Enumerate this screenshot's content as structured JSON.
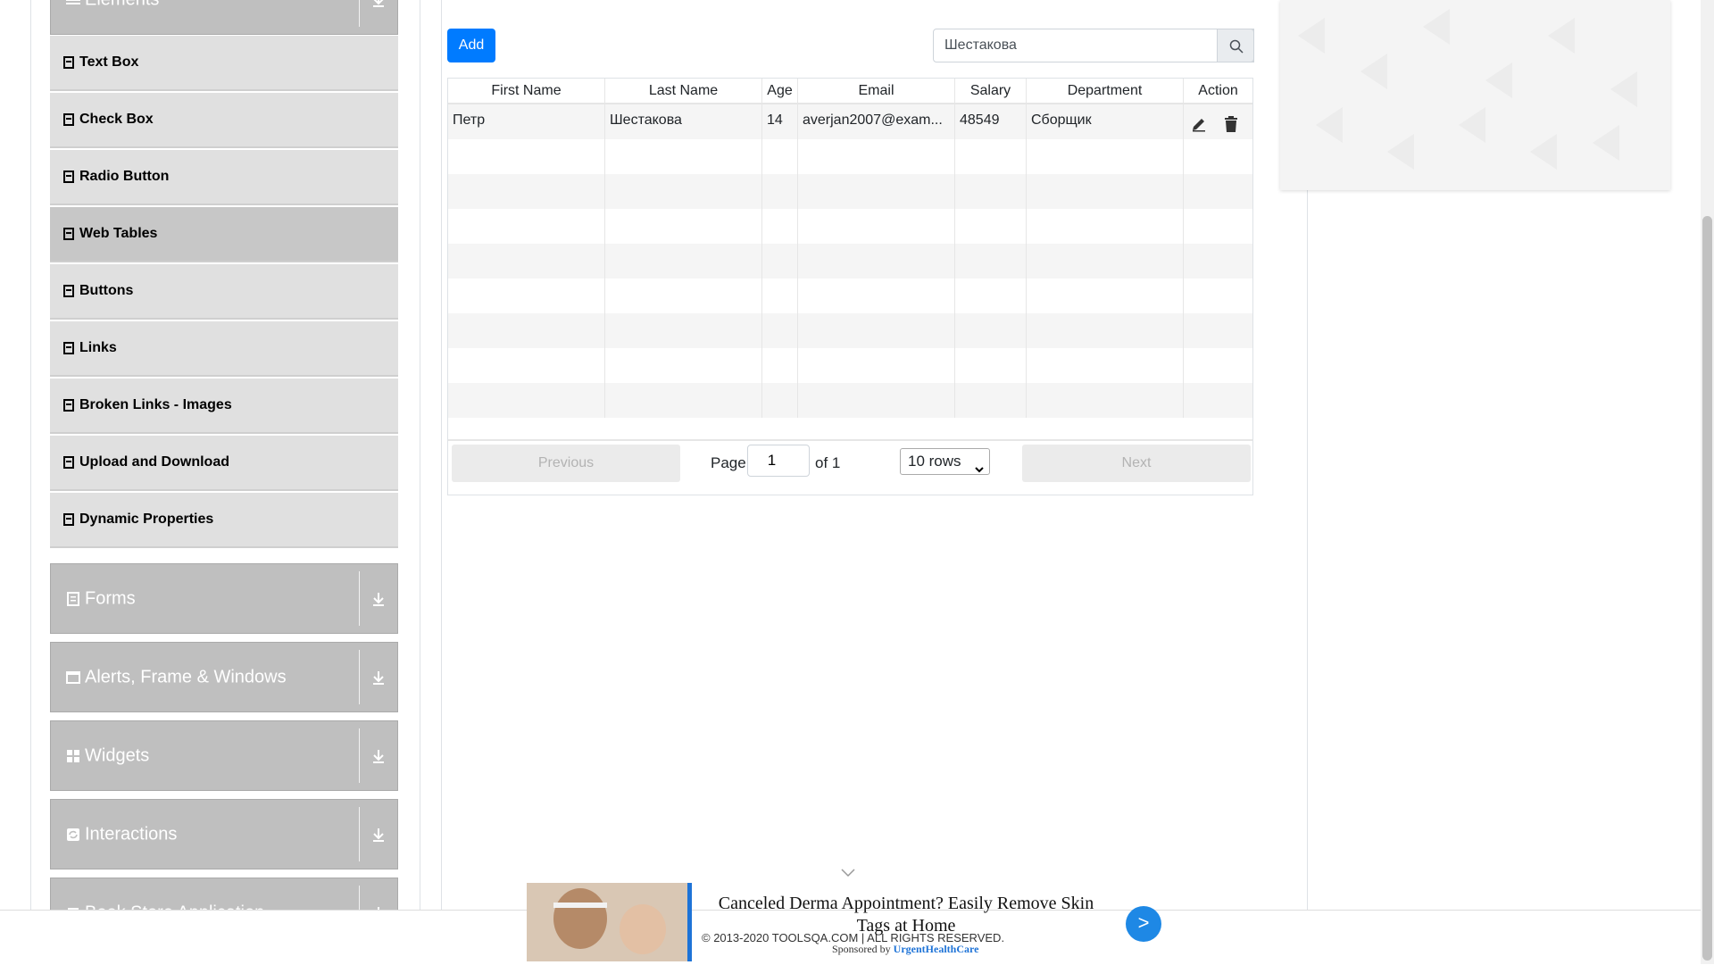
{
  "sidebar": {
    "elements_header": "Elements",
    "items": [
      {
        "label": "Text Box"
      },
      {
        "label": "Check Box"
      },
      {
        "label": "Radio Button"
      },
      {
        "label": "Web Tables"
      },
      {
        "label": "Buttons"
      },
      {
        "label": "Links"
      },
      {
        "label": "Broken Links - Images"
      },
      {
        "label": "Upload and Download"
      },
      {
        "label": "Dynamic Properties"
      }
    ],
    "groups": [
      {
        "label": "Forms"
      },
      {
        "label": "Alerts, Frame & Windows"
      },
      {
        "label": "Widgets"
      },
      {
        "label": "Interactions"
      },
      {
        "label": "Book Store Application"
      }
    ]
  },
  "toolbar": {
    "add_label": "Add",
    "search_value": "Шестакова"
  },
  "table": {
    "headers": [
      "First Name",
      "Last Name",
      "Age",
      "Email",
      "Salary",
      "Department",
      "Action"
    ],
    "rows": [
      {
        "first": "Петр",
        "last": "Шестакова",
        "age": "14",
        "email": "averjan2007@exam...",
        "salary": "48549",
        "department": "Сборщик"
      }
    ]
  },
  "pagination": {
    "previous": "Previous",
    "page_label": "Page",
    "page_value": "1",
    "of_label": "of 1",
    "rows_option": "10 rows",
    "next": "Next"
  },
  "ad": {
    "headline": "Canceled Derma Appointment? Easily Remove Skin Tags at Home",
    "sponsored_by": "Sponsored by",
    "sponsor": "UrgentHealthCare",
    "go": ">"
  },
  "footer": {
    "text": "© 2013-2020 TOOLSQA.COM | ALL RIGHTS RESERVED."
  },
  "colors": {
    "accent": "#007bff",
    "group_header": "#bfbfbf",
    "menu_item": "#e0e0e0",
    "menu_item_active": "#c7c7c7"
  }
}
